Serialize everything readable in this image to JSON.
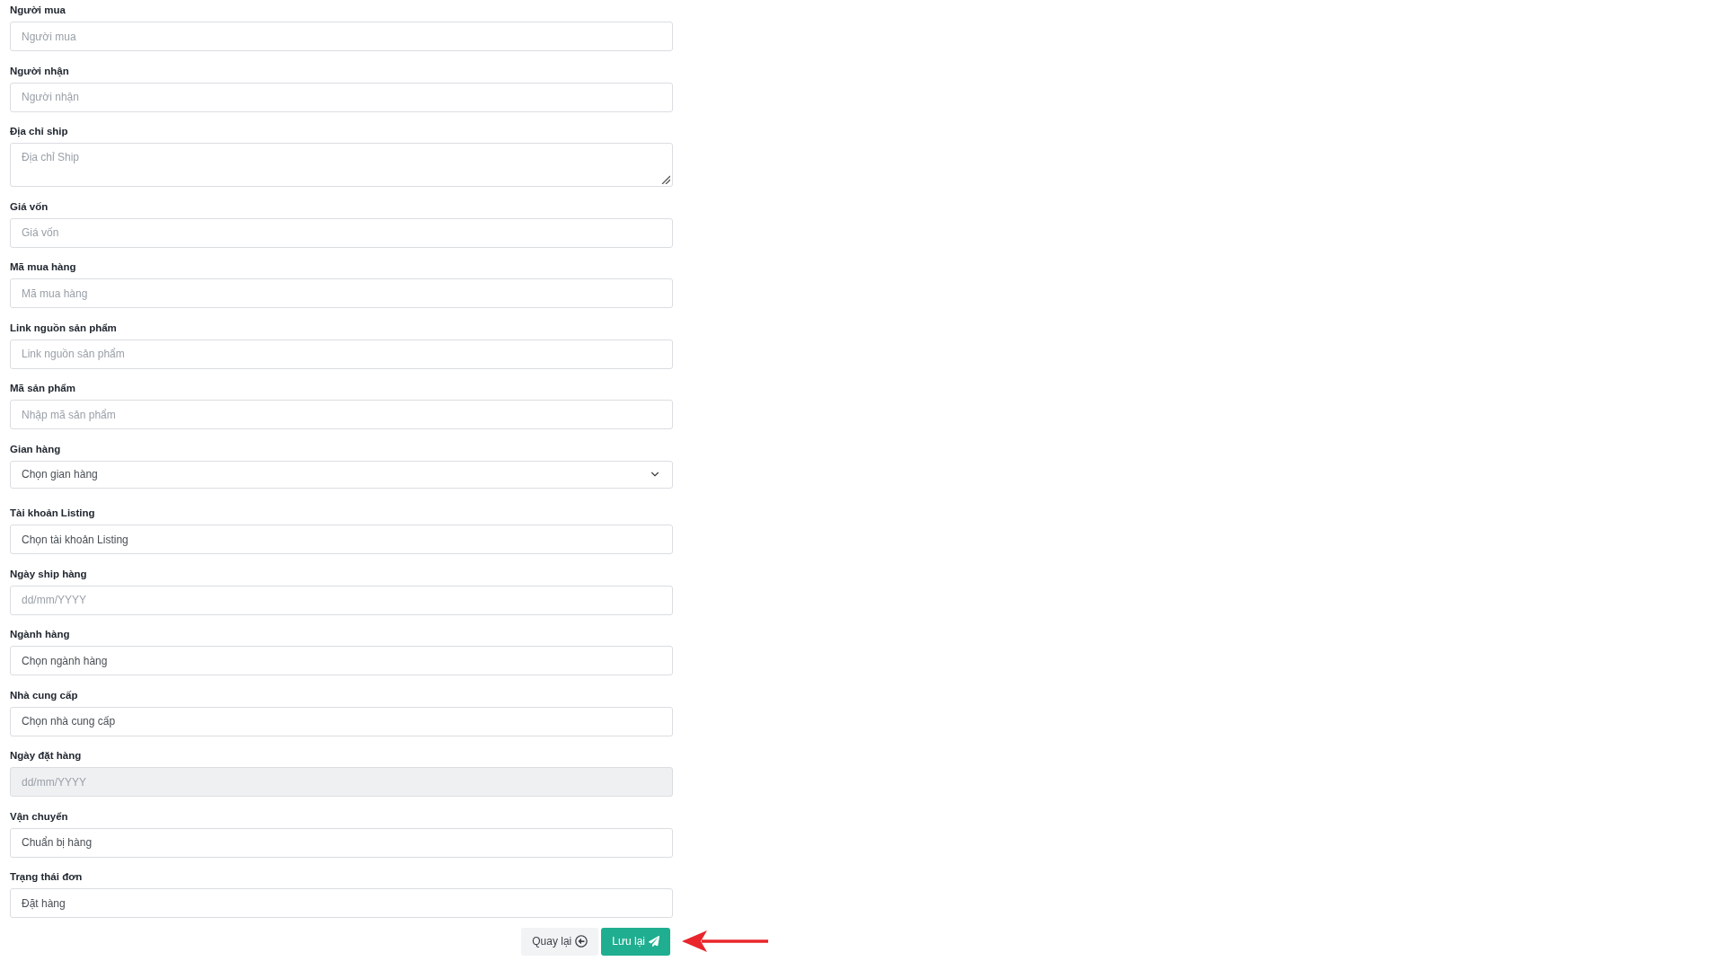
{
  "form": {
    "fields": [
      {
        "label": "Người mua",
        "kind": "text",
        "placeholder": "Người mua",
        "disabled": false
      },
      {
        "label": "Người nhận",
        "kind": "text",
        "placeholder": "Người nhận",
        "disabled": false
      },
      {
        "label": "Địa chỉ ship",
        "kind": "textarea",
        "placeholder": "Địa chỉ Ship",
        "disabled": false
      },
      {
        "label": "Giá vốn",
        "kind": "text",
        "placeholder": "Giá vốn",
        "disabled": false
      },
      {
        "label": "Mã mua hàng",
        "kind": "text",
        "placeholder": "Mã mua hàng",
        "disabled": false
      },
      {
        "label": "Link nguồn sản phẩm",
        "kind": "text",
        "placeholder": "Link nguồn sản phẩm",
        "disabled": false
      },
      {
        "label": "Mã sản phẩm",
        "kind": "text",
        "placeholder": "Nhập mã sản phẩm",
        "disabled": false
      },
      {
        "label": "Gian hàng",
        "kind": "select",
        "value": "Chọn gian hàng",
        "disabled": false
      },
      {
        "label": "Tài khoản Listing",
        "kind": "text",
        "value": "Chọn tài khoản Listing",
        "disabled": false
      },
      {
        "label": "Ngày ship hàng",
        "kind": "date",
        "placeholder": "dd/mm/YYYY",
        "disabled": false
      },
      {
        "label": "Ngành hàng",
        "kind": "text",
        "value": "Chọn ngành hàng",
        "disabled": false
      },
      {
        "label": "Nhà cung cấp",
        "kind": "text",
        "value": "Chọn nhà cung cấp",
        "disabled": false
      },
      {
        "label": "Ngày đặt hàng",
        "kind": "date",
        "placeholder": "dd/mm/YYYY",
        "disabled": true
      },
      {
        "label": "Vận chuyển",
        "kind": "text",
        "value": "Chuẩn bị hàng",
        "disabled": false
      },
      {
        "label": "Trạng thái đơn",
        "kind": "text",
        "value": "Đặt hàng",
        "disabled": false
      }
    ]
  },
  "buttons": [
    {
      "label": "Quay lại",
      "kind": "back"
    },
    {
      "label": "Lưu lại",
      "kind": "save"
    }
  ]
}
